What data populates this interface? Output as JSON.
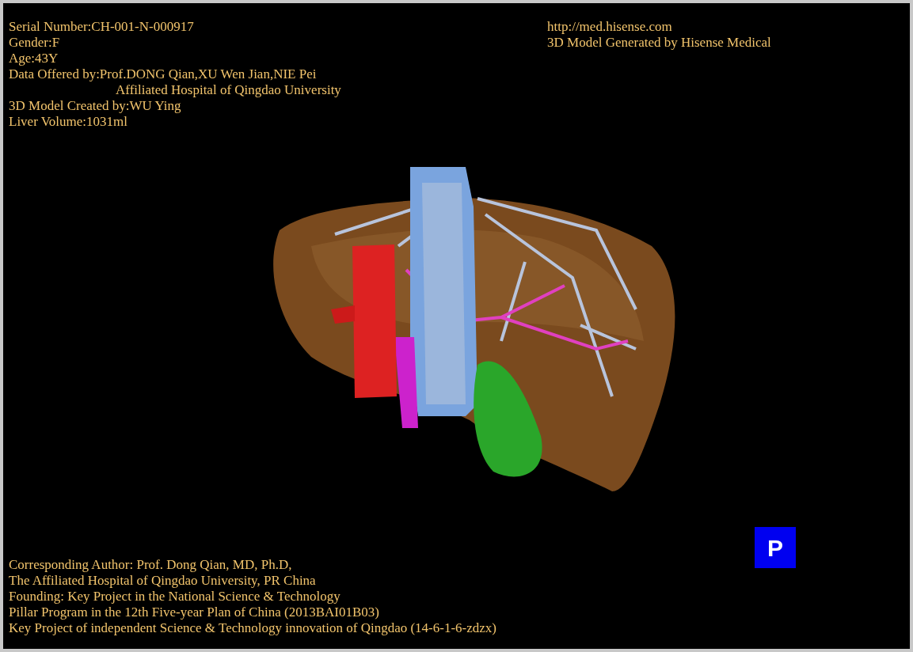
{
  "header_left": [
    {
      "text": "Serial Number:CH-001-N-000917",
      "indented": false
    },
    {
      "text": "Gender:F",
      "indented": false
    },
    {
      "text": "Age:43Y",
      "indented": false
    },
    {
      "text": "Data Offered by:Prof.DONG Qian,XU Wen Jian,NIE Pei",
      "indented": false
    },
    {
      "text": "Affiliated Hospital of Qingdao University",
      "indented": true
    },
    {
      "text": "3D Model Created by:WU Ying",
      "indented": false
    },
    {
      "text": "Liver Volume:1031ml",
      "indented": false
    }
  ],
  "header_right": [
    "http://med.hisense.com",
    "3D Model Generated by Hisense Medical"
  ],
  "footer": [
    "Corresponding Author: Prof. Dong Qian, MD, Ph.D,",
    "The Affiliated Hospital of Qingdao University, PR China",
    "Founding: Key Project in the National Science & Technology",
    "Pillar Program in the 12th Five-year Plan of China (2013BAI01B03)",
    "Key Project of independent Science & Technology innovation of Qingdao (14-6-1-6-zdzx)"
  ],
  "projection_button": "P"
}
